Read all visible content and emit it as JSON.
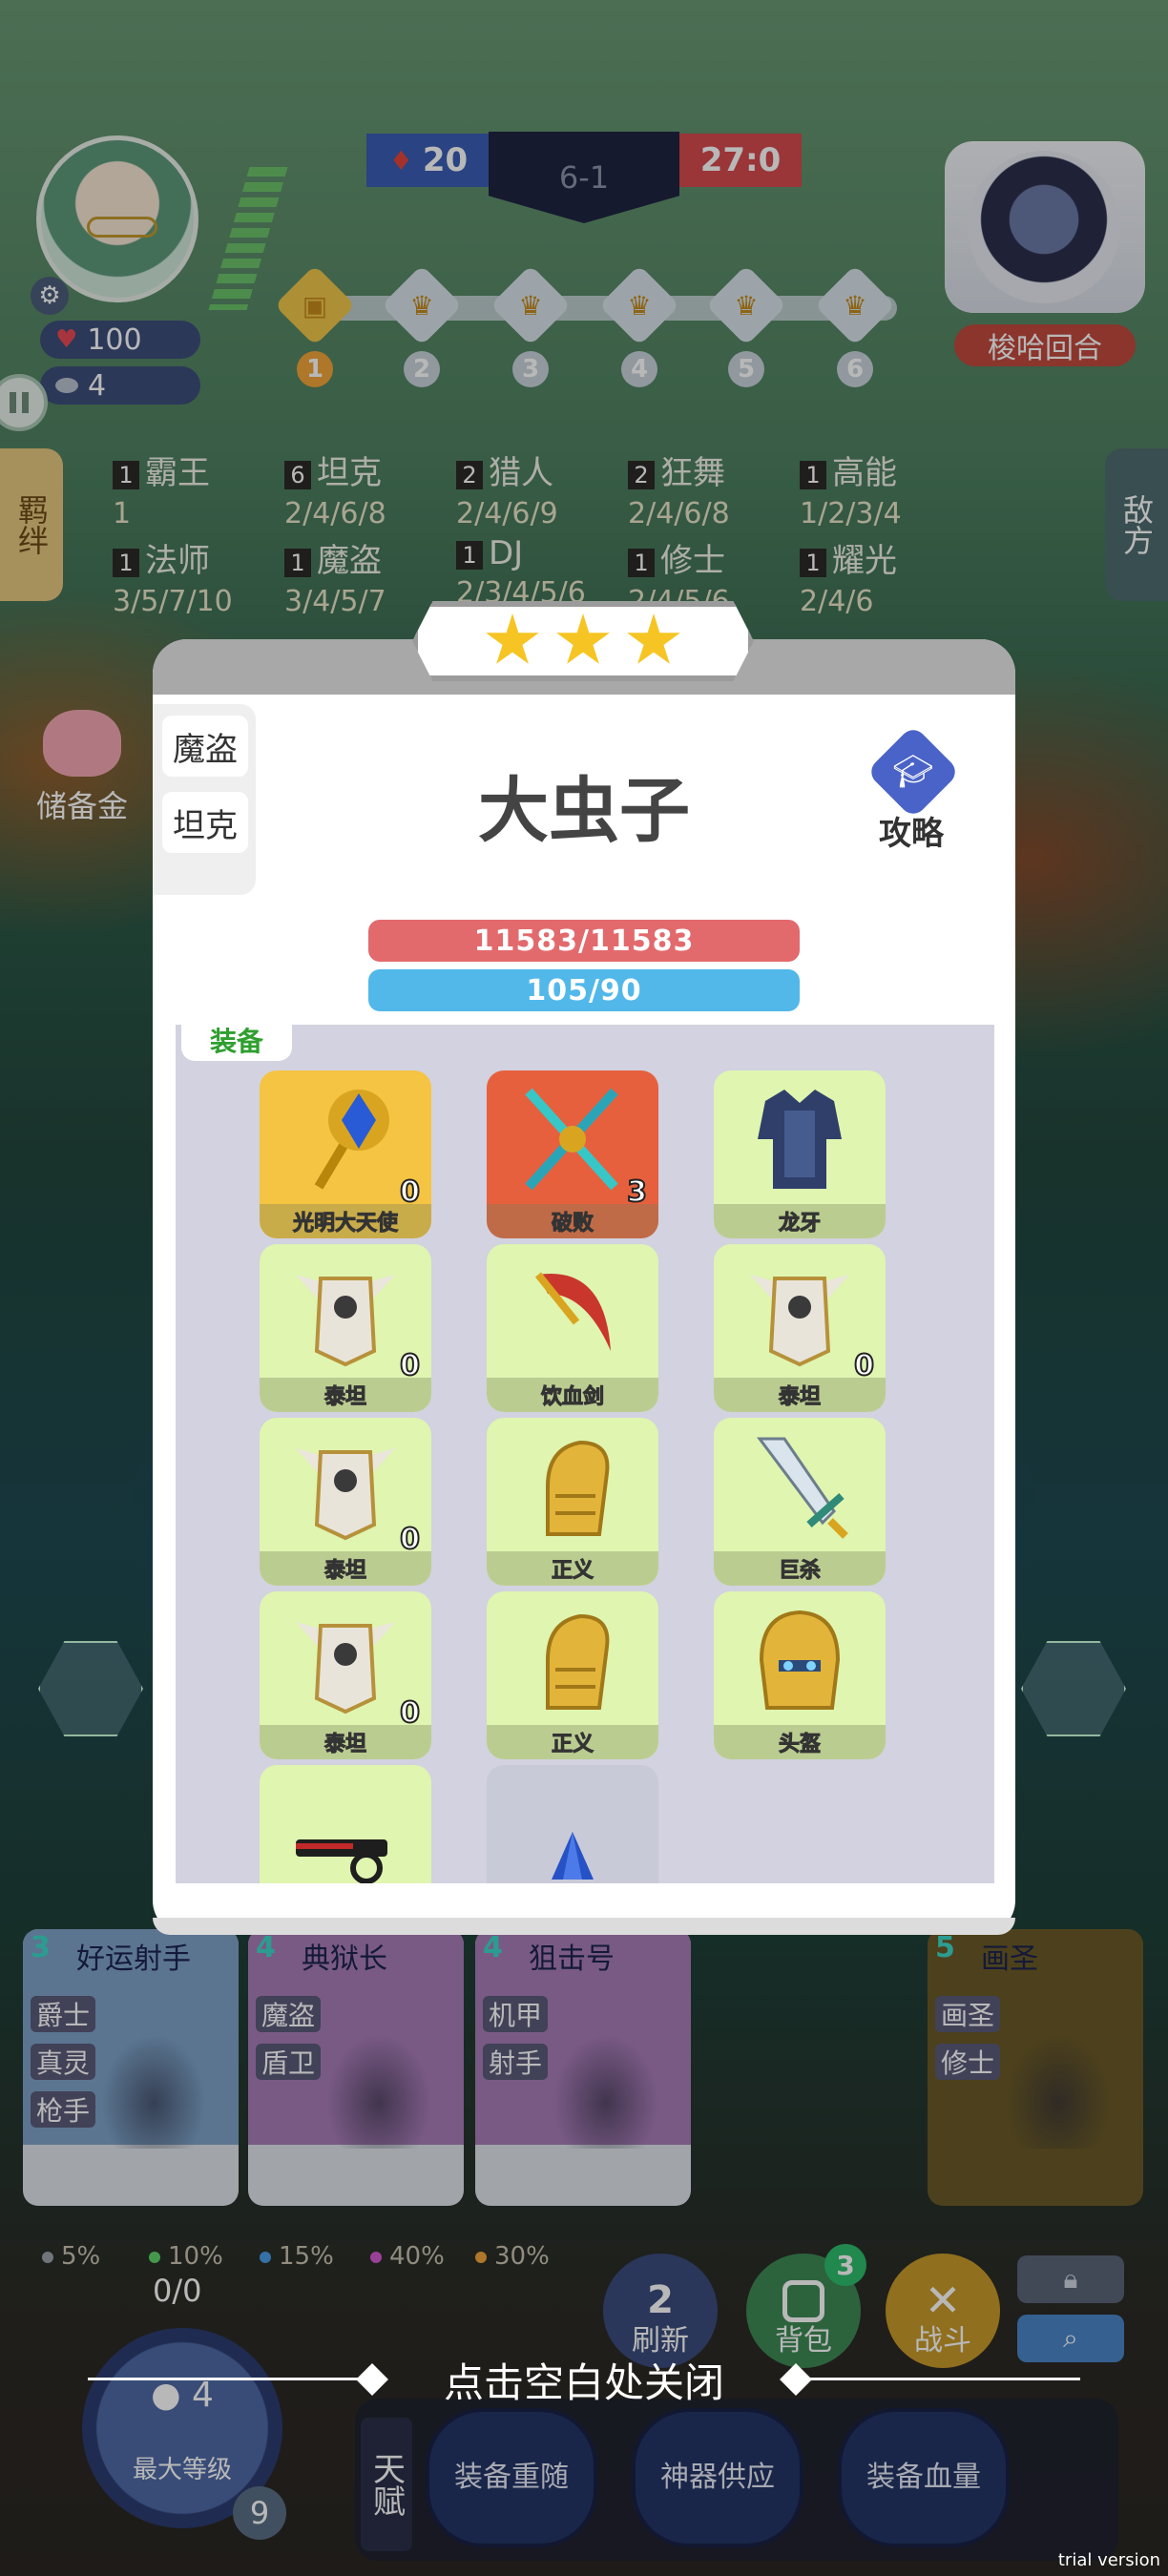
{
  "hud": {
    "hp": "100",
    "coins": "4",
    "score_left": "20",
    "round": "6-1",
    "score_right": "27:0",
    "round_numbers": [
      "1",
      "2",
      "3",
      "4",
      "5",
      "6"
    ],
    "enemy_name": "梭哈回合",
    "left_tab": "羁绊",
    "right_tab": "敌方",
    "savings_label": "储备金"
  },
  "traits": [
    {
      "count": "1",
      "name": "霸王",
      "levels": "1"
    },
    {
      "count": "6",
      "name": "坦克",
      "levels": "2/4/6/8"
    },
    {
      "count": "2",
      "name": "猎人",
      "levels": "2/4/6/9"
    },
    {
      "count": "2",
      "name": "狂舞",
      "levels": "2/4/6/8"
    },
    {
      "count": "1",
      "name": "高能",
      "levels": "1/2/3/4"
    },
    {
      "count": "1",
      "name": "法师",
      "levels": "3/5/7/10"
    },
    {
      "count": "1",
      "name": "魔盗",
      "levels": "3/4/5/7"
    },
    {
      "count": "1",
      "name": "DJ",
      "levels": "2/3/4/5/6"
    },
    {
      "count": "1",
      "name": "修士",
      "levels": "2/4/5/6"
    },
    {
      "count": "1",
      "name": "耀光",
      "levels": "2/4/6"
    }
  ],
  "modal": {
    "unit_name": "大虫子",
    "traits": [
      "魔盗",
      "坦克"
    ],
    "guide_label": "攻略",
    "hp": "11583/11583",
    "mp": "105/90",
    "equip_tab": "装备",
    "items": [
      {
        "name": "光明大天使",
        "level": "0",
        "style": "gold",
        "icon": "scepter-icon"
      },
      {
        "name": "破败",
        "level": "3",
        "style": "red",
        "icon": "crossed-swords-icon"
      },
      {
        "name": "龙牙",
        "level": "",
        "style": "green",
        "icon": "armor-icon"
      },
      {
        "name": "泰坦",
        "level": "0",
        "style": "green",
        "icon": "winged-chestplate-icon"
      },
      {
        "name": "饮血剑",
        "level": "",
        "style": "green",
        "icon": "scythe-icon"
      },
      {
        "name": "泰坦",
        "level": "0",
        "style": "green",
        "icon": "winged-chestplate-icon"
      },
      {
        "name": "泰坦",
        "level": "0",
        "style": "green",
        "icon": "winged-chestplate-icon"
      },
      {
        "name": "正义",
        "level": "",
        "style": "green",
        "icon": "gauntlet-icon"
      },
      {
        "name": "巨杀",
        "level": "",
        "style": "green",
        "icon": "greatsword-icon"
      },
      {
        "name": "泰坦",
        "level": "0",
        "style": "green",
        "icon": "winged-chestplate-icon"
      },
      {
        "name": "正义",
        "level": "",
        "style": "green",
        "icon": "gauntlet-icon"
      },
      {
        "name": "头盔",
        "level": "",
        "style": "green",
        "icon": "helmet-icon"
      },
      {
        "name": "",
        "level": "",
        "style": "green",
        "icon": "gun-icon"
      },
      {
        "name": "",
        "level": "",
        "style": "gray",
        "icon": "blue-gem-icon"
      }
    ]
  },
  "shop": [
    {
      "tier": "3",
      "name": "好运射手",
      "tags": [
        "爵士",
        "真灵",
        "枪手"
      ]
    },
    {
      "tier": "4",
      "name": "典狱长",
      "tags": [
        "魔盗",
        "盾卫"
      ]
    },
    {
      "tier": "4",
      "name": "狙击号",
      "tags": [
        "机甲",
        "射手"
      ]
    },
    {
      "tier": "5",
      "name": "画圣",
      "tags": [
        "画圣",
        "修士"
      ]
    }
  ],
  "odds": [
    {
      "value": "5%",
      "color": "#9aa3a8"
    },
    {
      "value": "10%",
      "color": "#5fd36a"
    },
    {
      "value": "15%",
      "color": "#4a9be6"
    },
    {
      "value": "40%",
      "color": "#d45ad0"
    },
    {
      "value": "30%",
      "color": "#f2a63a"
    }
  ],
  "level": {
    "xp": "0/0",
    "coins": "4",
    "label": "最大等级",
    "value": "9"
  },
  "actions": {
    "refresh_label": "刷新",
    "refresh_cost": "2",
    "bag_label": "背包",
    "bag_badge": "3",
    "fight_label": "战斗"
  },
  "talent": {
    "label": "天赋",
    "buttons": [
      "装备重随",
      "神器供应",
      "装备血量"
    ]
  },
  "close_hint": "点击空白处关闭",
  "trial": "trial version"
}
